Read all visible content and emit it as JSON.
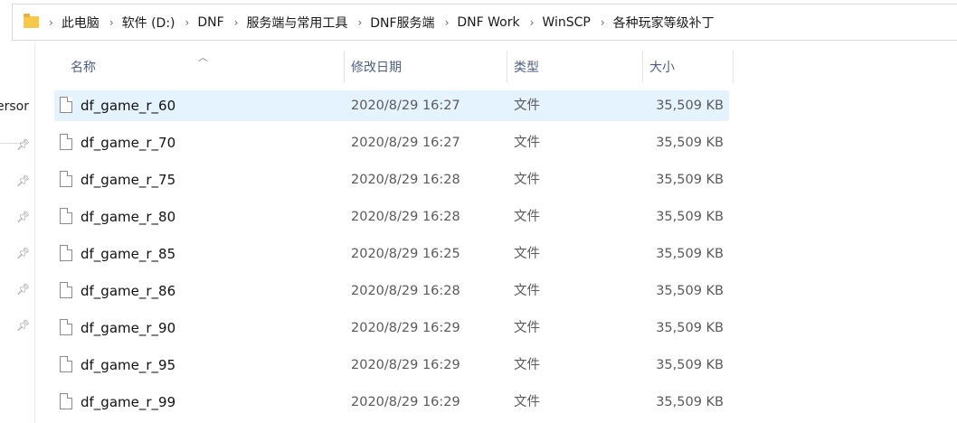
{
  "breadcrumb": [
    "此电脑",
    "软件 (D:)",
    "DNF",
    "服务端与常用工具",
    "DNF服务端",
    "DNF Work",
    "WinSCP",
    "各种玩家等级补丁"
  ],
  "sidebar": {
    "partial_label": "ersor"
  },
  "columns": {
    "name": "名称",
    "date": "修改日期",
    "type": "类型",
    "size": "大小"
  },
  "files": [
    {
      "name": "df_game_r_60",
      "date": "2020/8/29 16:27",
      "type": "文件",
      "size": "35,509 KB",
      "selected": true
    },
    {
      "name": "df_game_r_70",
      "date": "2020/8/29 16:27",
      "type": "文件",
      "size": "35,509 KB"
    },
    {
      "name": "df_game_r_75",
      "date": "2020/8/29 16:28",
      "type": "文件",
      "size": "35,509 KB"
    },
    {
      "name": "df_game_r_80",
      "date": "2020/8/29 16:28",
      "type": "文件",
      "size": "35,509 KB"
    },
    {
      "name": "df_game_r_85",
      "date": "2020/8/29 16:25",
      "type": "文件",
      "size": "35,509 KB"
    },
    {
      "name": "df_game_r_86",
      "date": "2020/8/29 16:28",
      "type": "文件",
      "size": "35,509 KB"
    },
    {
      "name": "df_game_r_90",
      "date": "2020/8/29 16:29",
      "type": "文件",
      "size": "35,509 KB"
    },
    {
      "name": "df_game_r_95",
      "date": "2020/8/29 16:29",
      "type": "文件",
      "size": "35,509 KB"
    },
    {
      "name": "df_game_r_99",
      "date": "2020/8/29 16:29",
      "type": "文件",
      "size": "35,509 KB"
    }
  ]
}
